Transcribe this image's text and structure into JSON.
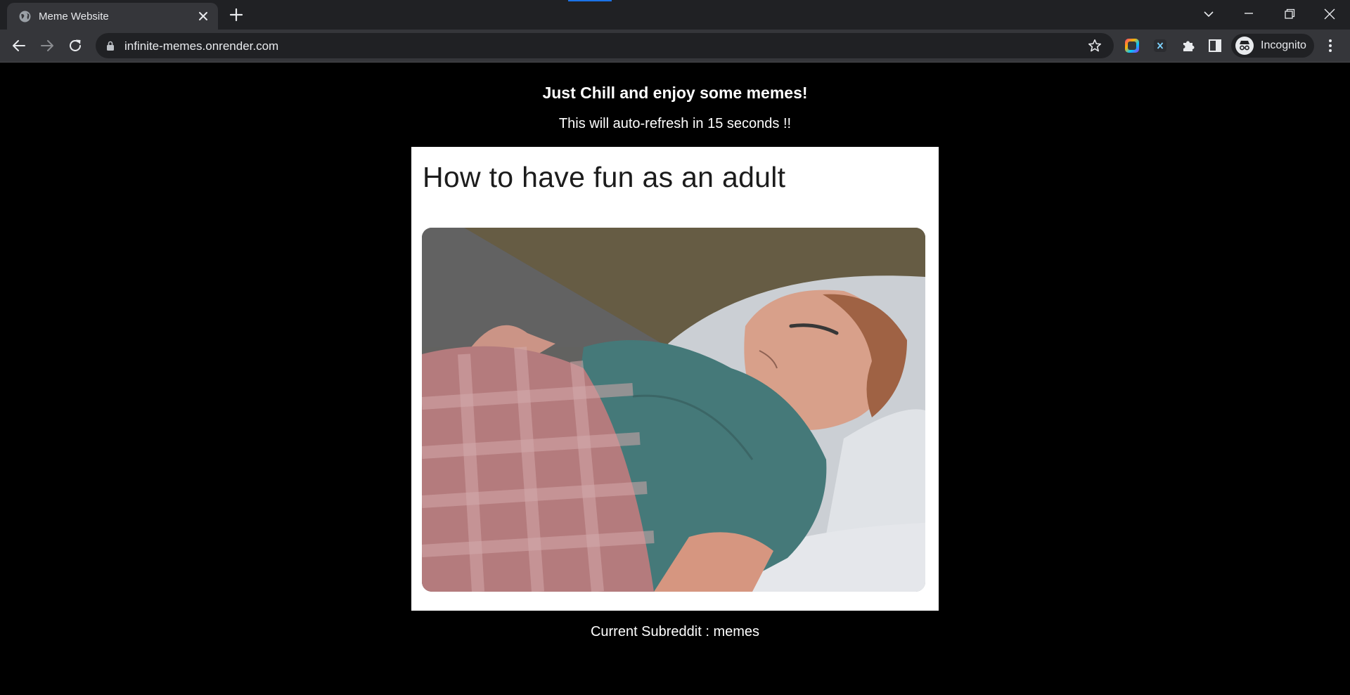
{
  "browser": {
    "tab": {
      "title": "Meme Website"
    },
    "address_bar": {
      "url": "infinite-memes.onrender.com"
    },
    "profile": {
      "label": "Incognito"
    }
  },
  "page": {
    "heading": "Just Chill and enjoy some memes!",
    "refresh_notice": "This will auto-refresh in 15 seconds !!",
    "meme": {
      "caption": "How to have fun as an adult"
    },
    "current_subreddit": "Current Subreddit : memes"
  },
  "colors": {
    "chrome_dark": "#202124",
    "chrome_toolbar": "#35363a",
    "page_background": "#000000",
    "page_text": "#ffffff"
  }
}
